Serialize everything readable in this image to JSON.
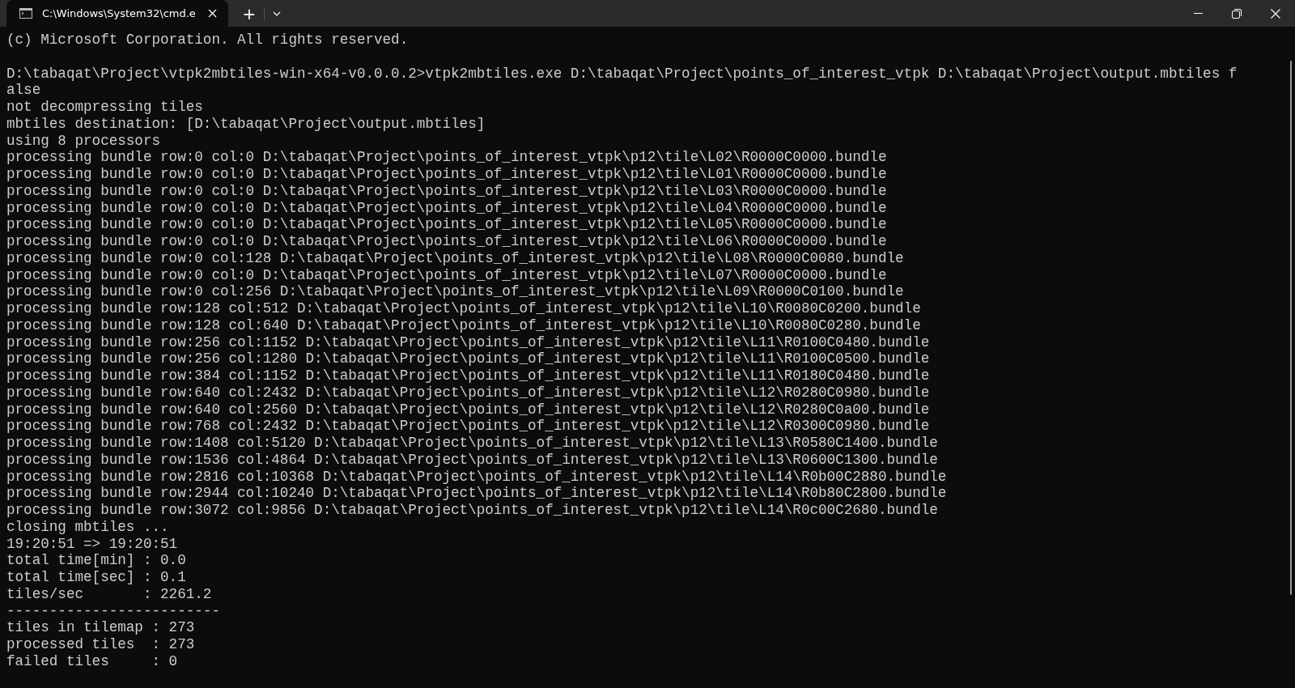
{
  "window": {
    "tab_title": "C:\\Windows\\System32\\cmd.e",
    "new_tab": "+"
  },
  "console": {
    "blocks": [
      [
        "(c) Microsoft Corporation. All rights reserved."
      ],
      [
        "D:\\tabaqat\\Project\\vtpk2mbtiles-win-x64-v0.0.0.2>vtpk2mbtiles.exe D:\\tabaqat\\Project\\points_of_interest_vtpk D:\\tabaqat\\Project\\output.mbtiles f",
        "alse",
        "not decompressing tiles",
        "mbtiles destination: [D:\\tabaqat\\Project\\output.mbtiles]",
        "using 8 processors",
        "processing bundle row:0 col:0 D:\\tabaqat\\Project\\points_of_interest_vtpk\\p12\\tile\\L02\\R0000C0000.bundle",
        "processing bundle row:0 col:0 D:\\tabaqat\\Project\\points_of_interest_vtpk\\p12\\tile\\L01\\R0000C0000.bundle",
        "processing bundle row:0 col:0 D:\\tabaqat\\Project\\points_of_interest_vtpk\\p12\\tile\\L03\\R0000C0000.bundle",
        "processing bundle row:0 col:0 D:\\tabaqat\\Project\\points_of_interest_vtpk\\p12\\tile\\L04\\R0000C0000.bundle",
        "processing bundle row:0 col:0 D:\\tabaqat\\Project\\points_of_interest_vtpk\\p12\\tile\\L05\\R0000C0000.bundle",
        "processing bundle row:0 col:0 D:\\tabaqat\\Project\\points_of_interest_vtpk\\p12\\tile\\L06\\R0000C0000.bundle",
        "processing bundle row:0 col:128 D:\\tabaqat\\Project\\points_of_interest_vtpk\\p12\\tile\\L08\\R0000C0080.bundle",
        "processing bundle row:0 col:0 D:\\tabaqat\\Project\\points_of_interest_vtpk\\p12\\tile\\L07\\R0000C0000.bundle",
        "processing bundle row:0 col:256 D:\\tabaqat\\Project\\points_of_interest_vtpk\\p12\\tile\\L09\\R0000C0100.bundle",
        "processing bundle row:128 col:512 D:\\tabaqat\\Project\\points_of_interest_vtpk\\p12\\tile\\L10\\R0080C0200.bundle",
        "processing bundle row:128 col:640 D:\\tabaqat\\Project\\points_of_interest_vtpk\\p12\\tile\\L10\\R0080C0280.bundle",
        "processing bundle row:256 col:1152 D:\\tabaqat\\Project\\points_of_interest_vtpk\\p12\\tile\\L11\\R0100C0480.bundle",
        "processing bundle row:256 col:1280 D:\\tabaqat\\Project\\points_of_interest_vtpk\\p12\\tile\\L11\\R0100C0500.bundle",
        "processing bundle row:384 col:1152 D:\\tabaqat\\Project\\points_of_interest_vtpk\\p12\\tile\\L11\\R0180C0480.bundle",
        "processing bundle row:640 col:2432 D:\\tabaqat\\Project\\points_of_interest_vtpk\\p12\\tile\\L12\\R0280C0980.bundle",
        "processing bundle row:640 col:2560 D:\\tabaqat\\Project\\points_of_interest_vtpk\\p12\\tile\\L12\\R0280C0a00.bundle",
        "processing bundle row:768 col:2432 D:\\tabaqat\\Project\\points_of_interest_vtpk\\p12\\tile\\L12\\R0300C0980.bundle",
        "processing bundle row:1408 col:5120 D:\\tabaqat\\Project\\points_of_interest_vtpk\\p12\\tile\\L13\\R0580C1400.bundle",
        "processing bundle row:1536 col:4864 D:\\tabaqat\\Project\\points_of_interest_vtpk\\p12\\tile\\L13\\R0600C1300.bundle",
        "processing bundle row:2816 col:10368 D:\\tabaqat\\Project\\points_of_interest_vtpk\\p12\\tile\\L14\\R0b00C2880.bundle",
        "processing bundle row:2944 col:10240 D:\\tabaqat\\Project\\points_of_interest_vtpk\\p12\\tile\\L14\\R0b80C2800.bundle",
        "processing bundle row:3072 col:9856 D:\\tabaqat\\Project\\points_of_interest_vtpk\\p12\\tile\\L14\\R0c00C2680.bundle",
        "closing mbtiles ...",
        "19:20:51 => 19:20:51",
        "total time[min] : 0.0",
        "total time[sec] : 0.1",
        "tiles/sec       : 2261.2",
        "-------------------------",
        "tiles in tilemap : 273",
        "processed tiles  : 273",
        "failed tiles     : 0"
      ]
    ]
  }
}
